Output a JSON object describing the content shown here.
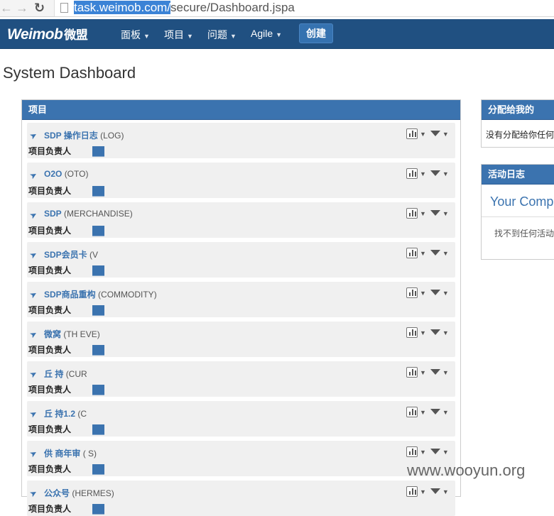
{
  "browser": {
    "url_highlighted": "task.weimob.com/",
    "url_rest": "secure/Dashboard.jspa"
  },
  "header": {
    "logo": "Weimob",
    "logo_cn": "微盟",
    "menus": [
      "面板",
      "项目",
      "问题",
      "Agile"
    ],
    "create_label": "创建"
  },
  "page": {
    "title": "System Dashboard"
  },
  "projects_gadget": {
    "title": "项目",
    "lead_label": "项目负责人",
    "rows": [
      {
        "name": "SDP 操作日志",
        "key": "(LOG)"
      },
      {
        "name": "O2O",
        "key": "(OTO)"
      },
      {
        "name": "SDP",
        "key": "(MERCHANDISE)"
      },
      {
        "name": "SDP会员卡",
        "key": "(V"
      },
      {
        "name": "SDP商品重构",
        "key": "(COMMODITY)"
      },
      {
        "name": "微窝",
        "key": "(TH EVE)"
      },
      {
        "name": "丘 持",
        "key": "(CUR"
      },
      {
        "name": "丘 持1.2",
        "key": "(C"
      },
      {
        "name": "供 商年审",
        "key": "( S)"
      },
      {
        "name": "公众号",
        "key": "(HERMES)"
      }
    ]
  },
  "assigned_gadget": {
    "title": "分配给我的",
    "body": "没有分配给你任何"
  },
  "activity_gadget": {
    "title": "活动日志",
    "subtitle": "Your Comp",
    "body": "找不到任何活动"
  },
  "watermark": "www.wooyun.org",
  "colors": {
    "header": "#205081",
    "gadget_head": "#3b73af",
    "create": "#3572b0"
  }
}
